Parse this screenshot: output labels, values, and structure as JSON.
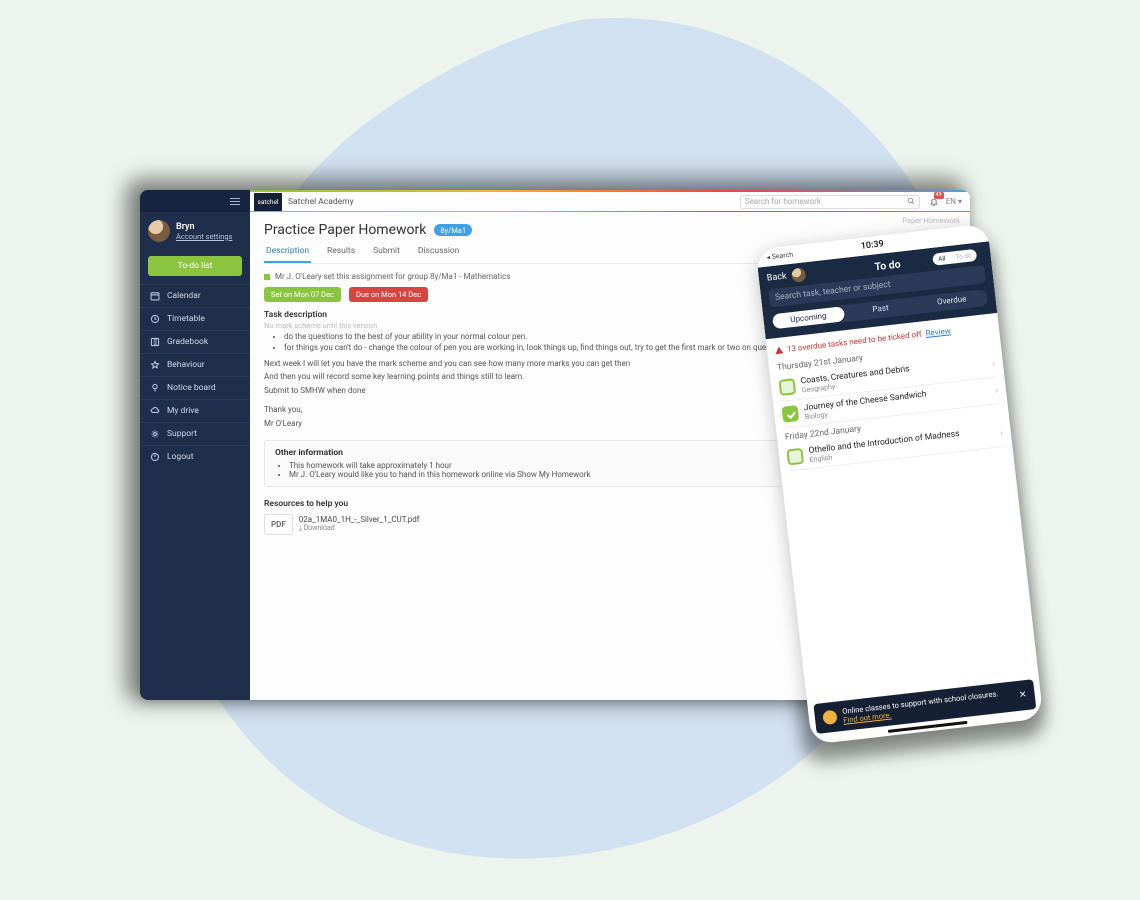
{
  "desktop": {
    "logo": "satchel",
    "school_name": "Satchel Academy",
    "search_placeholder": "Search for homework",
    "notification_count": "49",
    "lang": "EN ▾",
    "breadcrumb_right": "Paper Homework",
    "user": {
      "name": "Bryn",
      "account_link": "Account settings"
    },
    "todo_button": "To-do list",
    "nav": [
      {
        "label": "Calendar"
      },
      {
        "label": "Timetable"
      },
      {
        "label": "Gradebook"
      },
      {
        "label": "Behaviour"
      },
      {
        "label": "Notice board"
      },
      {
        "label": "My drive"
      },
      {
        "label": "Support"
      },
      {
        "label": "Logout"
      }
    ],
    "page": {
      "title": "Practice Paper Homework",
      "group_pill": "8y/Ma1",
      "tabs": [
        "Description",
        "Results",
        "Submit",
        "Discussion"
      ],
      "assigned_line": "Mr J. O'Leary set this assignment for group 8y/Ma1 - Mathematics",
      "chips": {
        "set": "Set on Mon 07 Dec",
        "due": "Due on Mon 14 Dec"
      },
      "task_description_label": "Task description",
      "prelude": "No mark scheme until this version",
      "bullets": [
        "do the questions to the best of your ability in your normal colour pen.",
        "for things you can't do - change the colour of pen you are working in, look things up, find things out, try to get the first mark or two on questions where you aren't sure"
      ],
      "paras": [
        "Next week I will let you have the mark scheme and you can see how many more marks you can get then",
        "And then you will record some key learning points and things still to learn.",
        "Submit to SMHW when done",
        "Thank you,",
        "Mr O'Leary"
      ],
      "other_info_heading": "Other information",
      "other_info": [
        "This homework will take approximately 1 hour",
        "Mr J. O'Leary would like you to hand in this homework online via Show My Homework"
      ],
      "resources_heading": "Resources to help you",
      "resource": {
        "badge": "PDF",
        "filename": "02a_1MA0_1H_-_Silver_1_CUT.pdf",
        "download": "⤓ Download"
      }
    }
  },
  "phone": {
    "status_search": "◂ Search",
    "status_time": "10:39",
    "back": "Back",
    "title": "To do",
    "toggle_all": "All",
    "toggle_todo": "To do",
    "search_placeholder": "Search task, teacher or subject",
    "seg_tabs": [
      "Upcoming",
      "Past",
      "Overdue"
    ],
    "overdue_warning": "13 overdue tasks need to be ticked off.",
    "overdue_link": "Review",
    "sections": [
      {
        "date": "Thursday 21st January",
        "tasks": [
          {
            "title": "Coasts, Creatures and Debris",
            "subject": "Geography",
            "checked": false
          },
          {
            "title": "Journey of the Cheese Sandwich",
            "subject": "Biology",
            "checked": true
          }
        ]
      },
      {
        "date": "Friday 22nd January",
        "tasks": [
          {
            "title": "Othello and the Introduction of Madness",
            "subject": "English",
            "checked": false
          }
        ]
      }
    ],
    "footer_text": "Online classes to support with school closures.",
    "footer_link": "Find out more."
  }
}
